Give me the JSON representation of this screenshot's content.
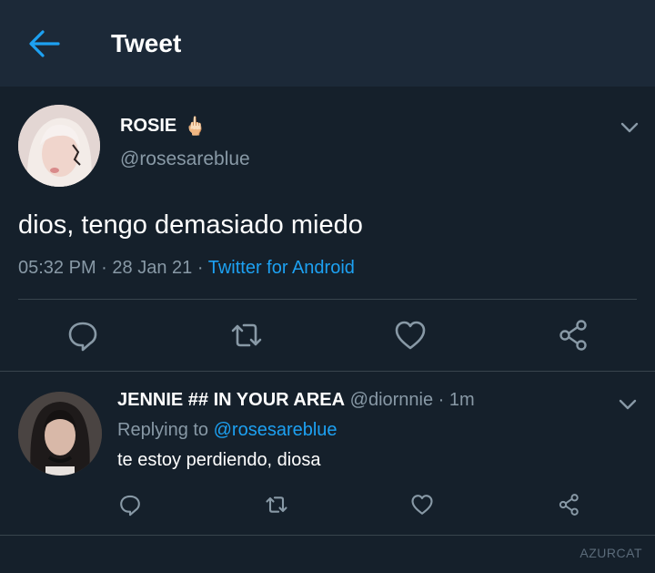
{
  "header": {
    "title": "Tweet",
    "back_icon": "arrow-left-icon",
    "accent": "#1da1f2"
  },
  "main_tweet": {
    "display_name": "ROSIE",
    "emoji": "🖕🏻",
    "handle": "@rosesareblue",
    "text": "dios, tengo demasiado miedo",
    "time": "05:32 PM",
    "date": "28 Jan 21",
    "separator": "·",
    "source": "Twitter for Android",
    "actions": [
      "reply-icon",
      "retweet-icon",
      "like-icon",
      "share-icon"
    ]
  },
  "reply": {
    "display_name": "JENNIE ## IN YOUR AREA",
    "handle": "@diornnie",
    "separator": "·",
    "time": "1m",
    "replying_label": "Replying to",
    "replying_to": "@rosesareblue",
    "text": "te estoy perdiendo, diosa",
    "actions": [
      "reply-icon",
      "retweet-icon",
      "like-icon",
      "share-icon"
    ]
  },
  "watermark": "AZURCAT",
  "colors": {
    "background": "#15202b",
    "header_bg": "#1c2938",
    "secondary_text": "#8899a6",
    "divider": "#38444d",
    "link": "#1da1f2"
  }
}
